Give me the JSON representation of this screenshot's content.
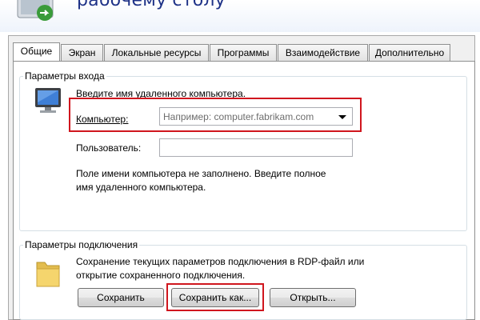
{
  "window": {
    "title_partial": "рабочему столу"
  },
  "tabs": [
    {
      "label": "Общие",
      "active": true
    },
    {
      "label": "Экран",
      "active": false
    },
    {
      "label": "Локальные ресурсы",
      "active": false
    },
    {
      "label": "Программы",
      "active": false
    },
    {
      "label": "Взаимодействие",
      "active": false
    },
    {
      "label": "Дополнительно",
      "active": false
    }
  ],
  "login_group": {
    "label": "Параметры входа",
    "prompt": "Введите имя удаленного компьютера.",
    "computer_label": "Компьютер:",
    "computer_placeholder": "Например: computer.fabrikam.com",
    "user_label": "Пользователь:",
    "user_value": "",
    "hint_line1": "Поле имени компьютера не заполнено. Введите полное",
    "hint_line2": "имя удаленного компьютера."
  },
  "connection_group": {
    "label": "Параметры подключения",
    "desc_line1": "Сохранение текущих параметров подключения в RDP-файл или",
    "desc_line2": "открытие сохраненного подключения.",
    "save_label": "Сохранить",
    "save_as_label": "Сохранить как...",
    "open_label": "Открыть..."
  },
  "highlight_color": "#d0161e",
  "icons": [
    "remote-desktop-icon",
    "monitor-icon",
    "folder-icon"
  ]
}
